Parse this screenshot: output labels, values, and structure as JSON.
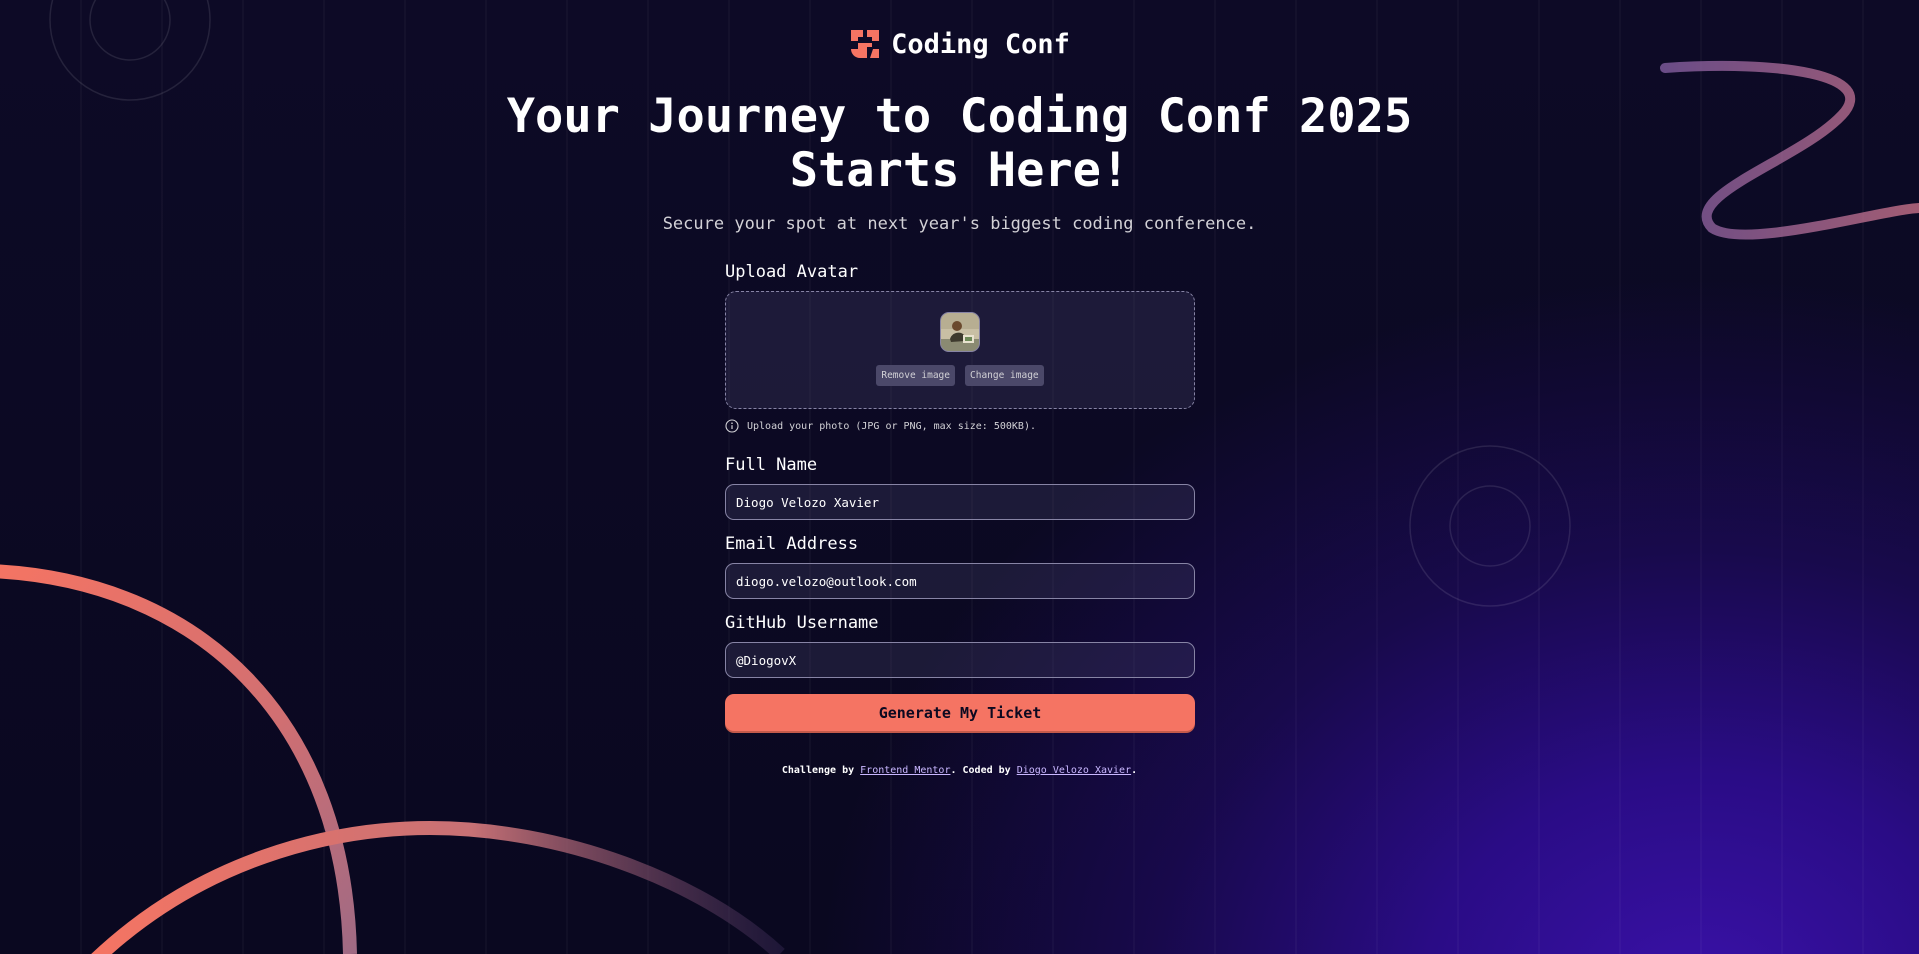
{
  "brand": {
    "name": "Coding Conf",
    "icon": "coding-conf-logo-icon",
    "accent_color": "#f57463"
  },
  "hero": {
    "title_line1": "Your Journey to Coding Conf 2025",
    "title_line2": "Starts Here!",
    "subtitle": "Secure your spot at next year's biggest coding conference."
  },
  "form": {
    "avatar": {
      "label": "Upload Avatar",
      "remove_label": "Remove image",
      "change_label": "Change image",
      "hint": "Upload your photo (JPG or PNG, max size: 500KB).",
      "hint_icon": "info-icon"
    },
    "full_name": {
      "label": "Full Name",
      "value": "Diogo Velozo Xavier"
    },
    "email": {
      "label": "Email Address",
      "value": "diogo.velozo@outlook.com"
    },
    "github": {
      "label": "GitHub Username",
      "value": "@DiogovX"
    },
    "submit_label": "Generate My Ticket"
  },
  "footer": {
    "prefix": "Challenge by ",
    "mentor_link": "Frontend Mentor",
    "middle": ". Coded by ",
    "author_link": "Diogo Velozo Xavier",
    "suffix": "."
  },
  "colors": {
    "background": "#0b0920",
    "glow": "#3a11a8",
    "input_border": "#8784a5",
    "button_text": "#0c0920"
  }
}
